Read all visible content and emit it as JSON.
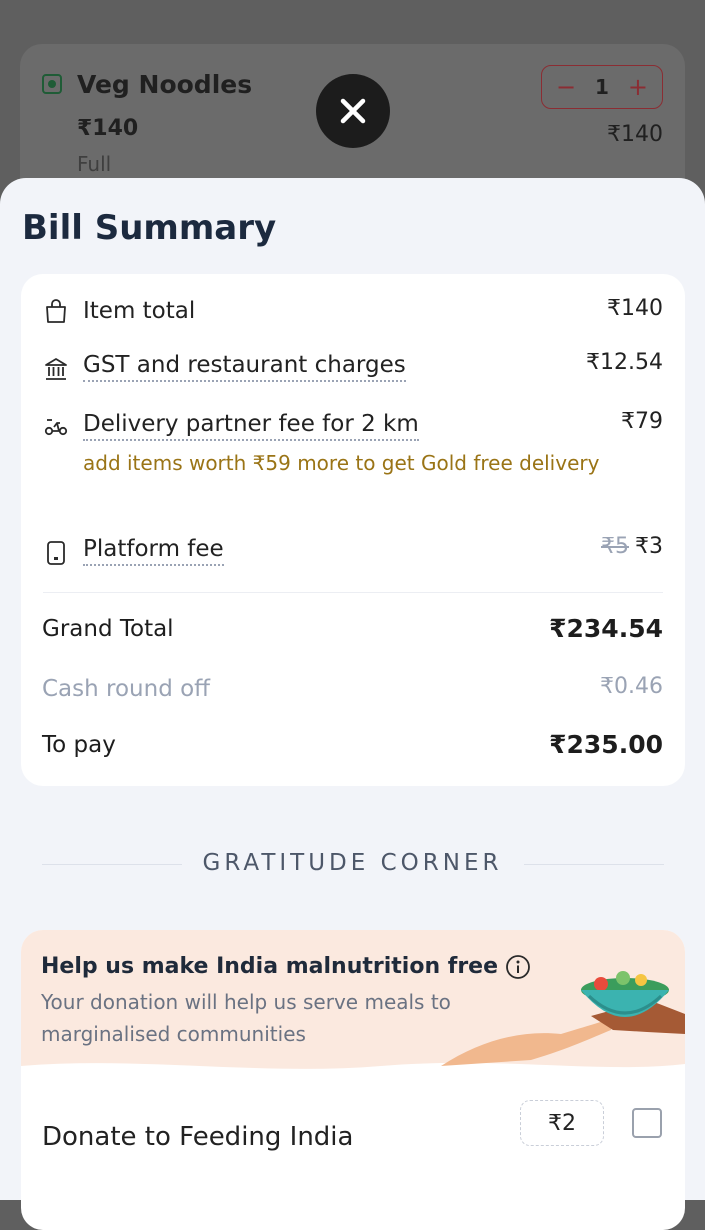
{
  "cart_item": {
    "name": "Veg Noodles",
    "price": "₹140",
    "variant": "Full",
    "quantity": "1",
    "line_total": "₹140",
    "decrement": "−",
    "increment": "+"
  },
  "bill": {
    "title": "Bill Summary",
    "rows": [
      {
        "label": "Item total",
        "amount": "₹140",
        "icon": "shopping-bag-icon"
      },
      {
        "label": "GST and restaurant charges",
        "amount": "₹12.54",
        "icon": "bank-icon"
      },
      {
        "label": "Delivery partner fee for 2 km",
        "amount": "₹79",
        "icon": "scooter-icon",
        "note": "add items worth ₹59 more to get Gold free delivery"
      },
      {
        "label": "Platform fee",
        "amount": "₹3",
        "original_amount": "₹5",
        "icon": "phone-icon"
      }
    ],
    "grand_total_label": "Grand Total",
    "grand_total": "₹234.54",
    "round_off_label": "Cash round off",
    "round_off": "₹0.46",
    "to_pay_label": "To pay",
    "to_pay": "₹235.00"
  },
  "gratitude": {
    "section_title": "GRATITUDE CORNER",
    "headline": "Help us make India malnutrition free",
    "description": "Your donation will help us serve meals to marginalised communities",
    "donate_label": "Donate to Feeding India",
    "donate_amount": "₹2",
    "checked": false
  },
  "colors": {
    "accent_note": "#9a7416",
    "stepper_red": "#8b2d33",
    "veg_green": "#1f5c36",
    "banner_peach": "#fbe9df"
  }
}
